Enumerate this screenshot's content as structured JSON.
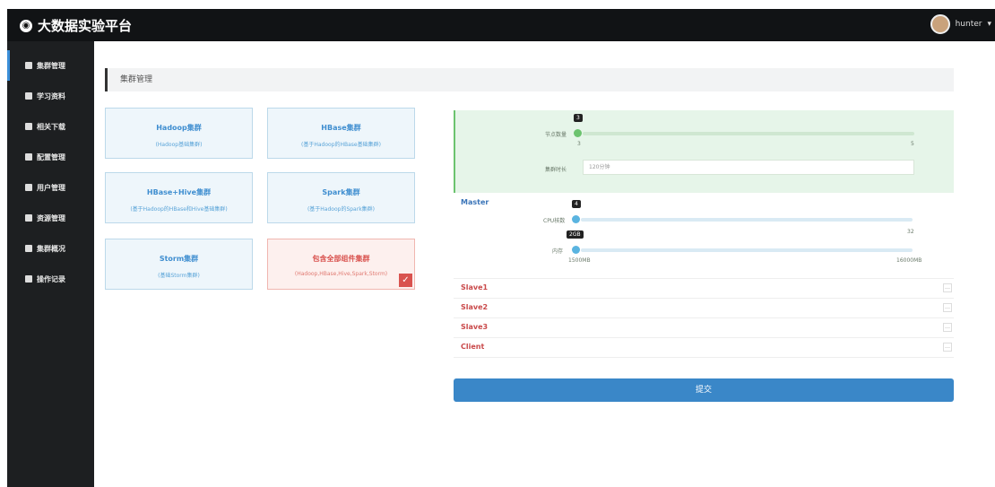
{
  "app": {
    "title": "大数据实验平台",
    "user": "hunter"
  },
  "sidebar": {
    "items": [
      {
        "label": "集群管理",
        "active": true
      },
      {
        "label": "学习资料"
      },
      {
        "label": "相关下载"
      },
      {
        "label": "配置管理"
      },
      {
        "label": "用户管理"
      },
      {
        "label": "资源管理"
      },
      {
        "label": "集群概况"
      },
      {
        "label": "操作记录"
      }
    ]
  },
  "breadcrumb": "集群管理",
  "cards": [
    {
      "title": "Hadoop集群",
      "sub": "(Hadoop基础集群)"
    },
    {
      "title": "HBase集群",
      "sub": "(基于Hadoop的HBase基础集群)"
    },
    {
      "title": "HBase+Hive集群",
      "sub": "(基于Hadoop的HBase和Hive基础集群)"
    },
    {
      "title": "Spark集群",
      "sub": "(基于Hadoop的Spark集群)"
    },
    {
      "title": "Storm集群",
      "sub": "(基础Storm集群)"
    },
    {
      "title": "包含全部组件集群",
      "sub": "(Hadoop,HBase,Hive,Spark,Storm)",
      "selected": true
    }
  ],
  "config": {
    "node_label": "节点数量",
    "node_value": "3",
    "node_min": "3",
    "node_max": "5",
    "time_label": "集群时长",
    "time_placeholder": "120分钟"
  },
  "master": {
    "title": "Master",
    "cpu_label": "CPU核数",
    "cpu_value": "4",
    "cpu_max": "32",
    "mem_label": "内存",
    "mem_value": "2GB",
    "mem_min": "1500MB",
    "mem_max": "16000MB"
  },
  "slaves": [
    {
      "name": "Slave1"
    },
    {
      "name": "Slave2"
    },
    {
      "name": "Slave3"
    },
    {
      "name": "Client"
    }
  ],
  "submit_label": "提交"
}
